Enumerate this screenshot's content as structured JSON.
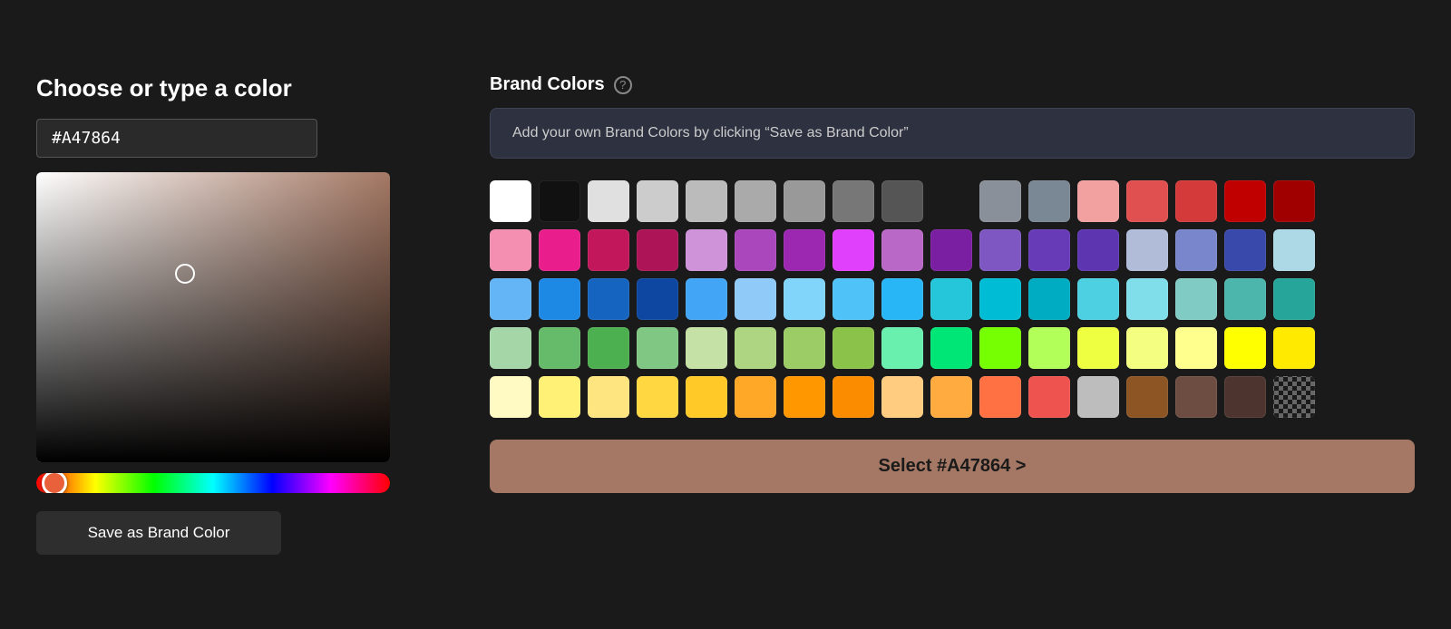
{
  "title": "Choose or type a color",
  "hex_input": {
    "value": "#A47864",
    "placeholder": "#A47864"
  },
  "save_brand_button": "Save as Brand Color",
  "brand_colors": {
    "title": "Brand Colors",
    "help_icon": "?",
    "hint": "Add your own Brand Colors by clicking “Save as Brand Color”",
    "rows": [
      [
        "#ffffff",
        "#111111",
        "#e0e0e0",
        "#cccccc",
        "#bbbbbb",
        "#aaaaaa",
        "#999999",
        "#777777",
        "#555555",
        "",
        "#8a9099",
        "#7a8794",
        "#f2a0a0",
        "#e05050",
        "#d43a3a",
        "#c00000",
        "#a00000"
      ],
      [
        "#f48fb1",
        "#e91e8c",
        "#c2185b",
        "#ad1457",
        "#ce93d8",
        "#ab47bc",
        "#9c27b0",
        "#e040fb",
        "#ba68c8",
        "#7b1fa2",
        "#7e57c2",
        "#673ab7",
        "#5e35b1",
        "#b0bcd8",
        "#7986cb",
        "#3949ab",
        "#add8e6"
      ],
      [
        "#64b5f6",
        "#1e88e5",
        "#1565c0",
        "#0d47a1",
        "#42a5f5",
        "#90caf9",
        "#81d4fa",
        "#4fc3f7",
        "#29b6f6",
        "#26c6da",
        "#00bcd4",
        "#00acc1",
        "#4dd0e1",
        "#80deea",
        "#80cbc4",
        "#4db6ac",
        "#26a69a"
      ],
      [
        "#a5d6a7",
        "#66bb6a",
        "#4caf50",
        "#81c784",
        "#c5e1a5",
        "#aed581",
        "#9ccc65",
        "#8bc34a",
        "#69f0ae",
        "#00e676",
        "#76ff03",
        "#b2ff59",
        "#eeff41",
        "#f4ff81",
        "#ffff8d",
        "#ffff00",
        "#ffea00"
      ],
      [
        "#fff9c4",
        "#fff176",
        "#ffe57f",
        "#ffd740",
        "#ffca28",
        "#ffa726",
        "#ff9800",
        "#fb8c00",
        "#ffcc80",
        "#ffab40",
        "#ff7043",
        "#ef5350",
        "#bdbdbd",
        "#8d5524",
        "#6d4c41",
        "#4e342e",
        ""
      ]
    ],
    "select_button": "Select #A47864 >"
  },
  "current_color": "#A47864",
  "hue_color": "#e8613a"
}
